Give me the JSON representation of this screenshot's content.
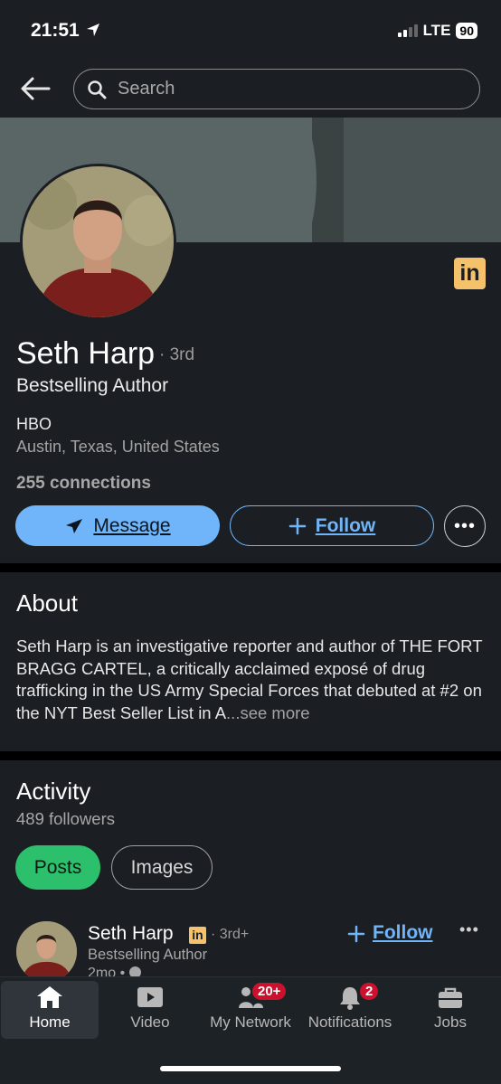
{
  "status": {
    "time": "21:51",
    "network": "LTE",
    "battery": "90"
  },
  "header": {
    "search_placeholder": "Search"
  },
  "profile": {
    "name": "Seth Harp",
    "degree": "· 3rd",
    "headline": "Bestselling Author",
    "company": "HBO",
    "location": "Austin, Texas, United States",
    "connections": "255 connections",
    "linkedin_badge": "in"
  },
  "actions": {
    "message": "Message",
    "follow": "Follow",
    "more": "•••"
  },
  "about": {
    "title": "About",
    "text": "Seth Harp is an investigative reporter and author of THE FORT BRAGG CARTEL, a critically acclaimed exposé of drug trafficking in the US Army Special Forces that debuted at #2 on the NYT Best Seller List in A",
    "see_more": "...see more"
  },
  "activity": {
    "title": "Activity",
    "followers": "489 followers",
    "tabs": [
      "Posts",
      "Images"
    ],
    "post": {
      "author": "Seth Harp",
      "badge": "in",
      "degree": "· 3rd+",
      "headline": "Bestselling Author",
      "time": "2mo •",
      "follow": "Follow",
      "more": "•••"
    }
  },
  "nav": {
    "items": [
      {
        "label": "Home"
      },
      {
        "label": "Video"
      },
      {
        "label": "My Network",
        "badge": "20+"
      },
      {
        "label": "Notifications",
        "badge": "2"
      },
      {
        "label": "Jobs"
      }
    ]
  },
  "colors": {
    "accent": "#70b5f9",
    "posts_pill": "#2cbf6c",
    "premium": "#f5c26b",
    "badge": "#cb112d"
  }
}
